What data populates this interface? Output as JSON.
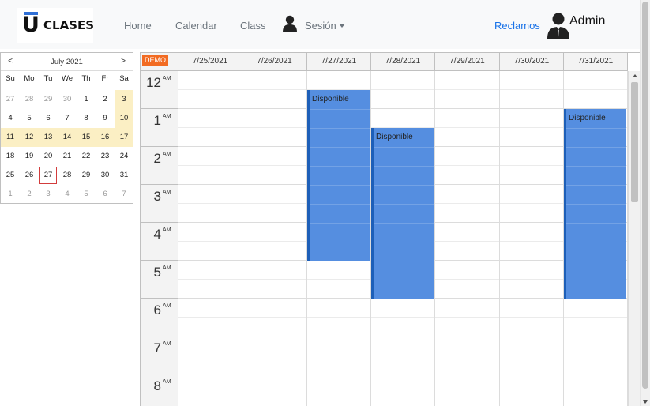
{
  "navbar": {
    "logo_u": "U",
    "logo_text": "CLASES",
    "links": [
      "Home",
      "Calendar",
      "Class"
    ],
    "sesion_label": "Sesión",
    "reclamos_label": "Reclamos",
    "admin_label": "Admin"
  },
  "minicalendar": {
    "title": "July 2021",
    "prev": "<",
    "next": ">",
    "days_of_week": [
      "Su",
      "Mo",
      "Tu",
      "We",
      "Th",
      "Fr",
      "Sa"
    ],
    "weeks": [
      [
        "27",
        "28",
        "29",
        "30",
        "1",
        "2",
        "3"
      ],
      [
        "4",
        "5",
        "6",
        "7",
        "8",
        "9",
        "10"
      ],
      [
        "11",
        "12",
        "13",
        "14",
        "15",
        "16",
        "17"
      ],
      [
        "18",
        "19",
        "20",
        "21",
        "22",
        "23",
        "24"
      ],
      [
        "25",
        "26",
        "27",
        "28",
        "29",
        "30",
        "31"
      ],
      [
        "1",
        "2",
        "3",
        "4",
        "5",
        "6",
        "7"
      ]
    ],
    "today": "27"
  },
  "calendar": {
    "badge": "DEMO",
    "columns": [
      "7/25/2021",
      "7/26/2021",
      "7/27/2021",
      "7/28/2021",
      "7/29/2021",
      "7/30/2021",
      "7/31/2021"
    ],
    "hours": [
      {
        "h": "12",
        "ap": "AM"
      },
      {
        "h": "1",
        "ap": "AM"
      },
      {
        "h": "2",
        "ap": "AM"
      },
      {
        "h": "3",
        "ap": "AM"
      },
      {
        "h": "4",
        "ap": "AM"
      },
      {
        "h": "5",
        "ap": "AM"
      },
      {
        "h": "6",
        "ap": "AM"
      },
      {
        "h": "7",
        "ap": "AM"
      },
      {
        "h": "8",
        "ap": "AM"
      }
    ],
    "events": [
      {
        "col": 2,
        "start": 0.5,
        "end": 5.0,
        "label": "Disponible"
      },
      {
        "col": 3,
        "start": 1.5,
        "end": 6.0,
        "label": "Disponible"
      },
      {
        "col": 6,
        "start": 1.0,
        "end": 6.0,
        "label": "Disponible"
      }
    ]
  },
  "colors": {
    "event_fill": "#558ee0",
    "event_border": "#1d5fb8",
    "highlight_week": "#fbefc4",
    "today_outline": "#d23c3c",
    "badge": "#f26b22",
    "link": "#1a73e8"
  }
}
